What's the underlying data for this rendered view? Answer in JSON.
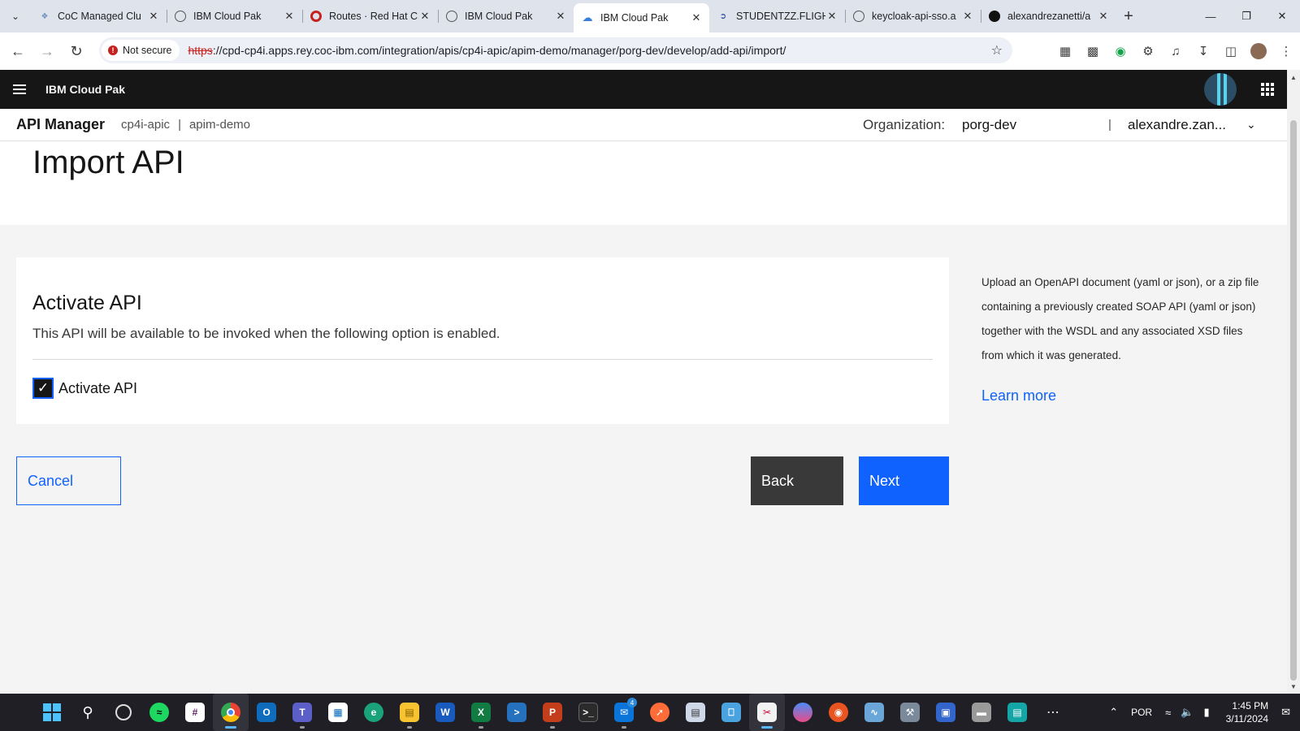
{
  "browser": {
    "tabs": [
      {
        "title": "CoC Managed Clu",
        "favicon": "puzzle",
        "color": "#6e8fb8"
      },
      {
        "title": "IBM Cloud Pak",
        "favicon": "globe",
        "color": "#555555"
      },
      {
        "title": "Routes · Red Hat C",
        "favicon": "openshift",
        "color": "#c5221f"
      },
      {
        "title": "IBM Cloud Pak",
        "favicon": "globe",
        "color": "#555555"
      },
      {
        "title": "IBM Cloud Pak",
        "favicon": "cloud",
        "color": "#3a7fd8",
        "active": true
      },
      {
        "title": "STUDENTZZ.FLIGH",
        "favicon": "api",
        "color": "#2a4d9a"
      },
      {
        "title": "keycloak-api-sso.a",
        "favicon": "globe",
        "color": "#555555"
      },
      {
        "title": "alexandrezanetti/a",
        "favicon": "github",
        "color": "#111111"
      }
    ],
    "security_label": "Not secure",
    "url_protocol": "https",
    "url_rest": "://cpd-cp4i.apps.rey.coc-ibm.com/integration/apis/cp4i-apic/apim-demo/manager/porg-dev/develop/add-api/import/"
  },
  "header": {
    "brand": "IBM Cloud Pak"
  },
  "apibar": {
    "product": "API Manager",
    "crumb1": "cp4i-apic",
    "separator": "|",
    "crumb2": "apim-demo",
    "org_label": "Organization:",
    "org_value": "porg-dev",
    "user_separator": "|",
    "user": "alexandre.zan..."
  },
  "page": {
    "title": "Import API",
    "card": {
      "heading": "Activate API",
      "description": "This API will be available to be invoked when the following option is enabled.",
      "checkbox_label": "Activate API",
      "checked": true
    },
    "help": {
      "line1": "Upload an OpenAPI document (yaml or json), or a zip file",
      "line2": "containing a previously created SOAP API (yaml or json)",
      "line3": "together with the WSDL and any associated XSD files",
      "line4": "from which it was generated.",
      "link": "Learn more"
    },
    "buttons": {
      "cancel": "Cancel",
      "back": "Back",
      "next": "Next"
    }
  },
  "taskbar": {
    "language": "POR",
    "time": "1:45 PM",
    "date": "3/11/2024",
    "mail_badge": "4"
  },
  "colors": {
    "primary": "#0f62fe",
    "header_bg": "#161616",
    "back_btn": "#393939"
  }
}
